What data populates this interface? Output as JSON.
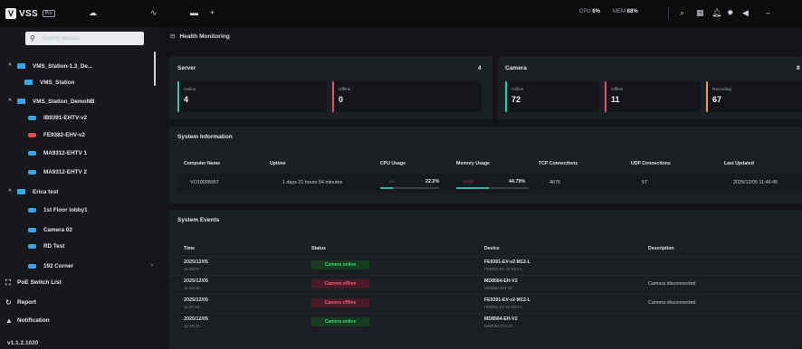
{
  "app": {
    "logo_text": "VSS",
    "badge": "Pro"
  },
  "topbar": {
    "cpu_label": "CPU",
    "cpu_value": "6%",
    "mem_label": "MEM",
    "mem_value": "88%"
  },
  "sidebar": {
    "search_placeholder": "Search devices",
    "tree": [
      {
        "label": "VMS_Station-1.3_De...",
        "type": "folder",
        "level": 0,
        "expanded": true
      },
      {
        "label": "VMS_Station",
        "type": "folder",
        "level": 1
      },
      {
        "label": "VMS_Station_DemoNB",
        "type": "folder",
        "level": 1,
        "expanded": true
      },
      {
        "label": "IB9391-EHTV-v2",
        "type": "camera",
        "level": 2,
        "status": "online"
      },
      {
        "label": "FE9382-EHV-v2",
        "type": "camera",
        "level": 2,
        "status": "offline"
      },
      {
        "label": "MA9312-EHTV 1",
        "type": "camera",
        "level": 2,
        "status": "online"
      },
      {
        "label": "MA9312-EHTV 2",
        "type": "camera",
        "level": 2,
        "status": "online"
      },
      {
        "label": "Erica test",
        "type": "folder",
        "level": 0,
        "expanded": true
      },
      {
        "label": "1st Floor lobby1",
        "type": "camera",
        "level": 2,
        "status": "online"
      },
      {
        "label": "Camera 02",
        "type": "camera",
        "level": 2,
        "status": "online"
      },
      {
        "label": "RD Test",
        "type": "camera",
        "level": 2,
        "status": "online"
      },
      {
        "label": "192 Corner",
        "type": "camera",
        "level": 2,
        "status": "online"
      }
    ],
    "nav": [
      {
        "label": "PoE Switch List"
      },
      {
        "label": "Report"
      },
      {
        "label": "Notification"
      }
    ],
    "version": "v1.1.2.1020"
  },
  "main": {
    "title": "Health Monitoring",
    "server": {
      "title": "Server",
      "count": "4",
      "cards": [
        {
          "label": "Online",
          "value": "4",
          "color": "#2ec4a6"
        },
        {
          "label": "Offline",
          "value": "0",
          "color": "#e0566a"
        }
      ]
    },
    "camera": {
      "title": "Camera",
      "count": "8",
      "cards": [
        {
          "label": "Online",
          "value": "72",
          "color": "#2ec4a6"
        },
        {
          "label": "Offline",
          "value": "11",
          "color": "#e0566a"
        },
        {
          "label": "Recording",
          "value": "67",
          "color": "#e8a33a"
        }
      ]
    },
    "system_info": {
      "title": "System Information",
      "headers": [
        "Computer Name",
        "Uptime",
        "CPU Usage",
        "Memory Usage",
        "TCP Connections",
        "UDP Connections",
        "Last Updated"
      ],
      "row": {
        "computer": "VO10008957",
        "uptime": "1 days 21 hours 54 minutes",
        "cpu_hint": "10%",
        "cpu": "22.2%",
        "cpu_pct": 0.222,
        "mem_hint": "32 GB",
        "mem": "44.79%",
        "mem_pct": 0.4479,
        "tcp": "4675",
        "udp": "57",
        "updated": "2025/12/05 11:46:45"
      }
    },
    "events": {
      "title": "System Events",
      "headers": [
        "Time",
        "Status",
        "Device",
        "Description"
      ],
      "rows": [
        {
          "date": "2025/12/05",
          "time": "11:40:37",
          "status": "Camera online",
          "kind": "on",
          "device": "FE9391-EV-v2-M12-L",
          "device_sub": "FE9391-EV-v2-M12-L",
          "desc": ""
        },
        {
          "date": "2025/12/05",
          "time": "11:40:33",
          "status": "Camera offline",
          "kind": "off",
          "device": "MD8564-EH-V2",
          "device_sub": "MD8564-EH-V2",
          "desc": "Camera disconnected"
        },
        {
          "date": "2025/12/05",
          "time": "11:40:16",
          "status": "Camera offline",
          "kind": "off",
          "device": "FE9391-EV-v2-M12-L",
          "device_sub": "FE9391-EV-v2-M12-L",
          "desc": "Camera disconnected"
        },
        {
          "date": "2025/12/05",
          "time": "11:40:41",
          "status": "Camera online",
          "kind": "on",
          "device": "MD8564-EH-V2",
          "device_sub": "MD8564-EH-V2",
          "desc": ""
        }
      ]
    }
  }
}
